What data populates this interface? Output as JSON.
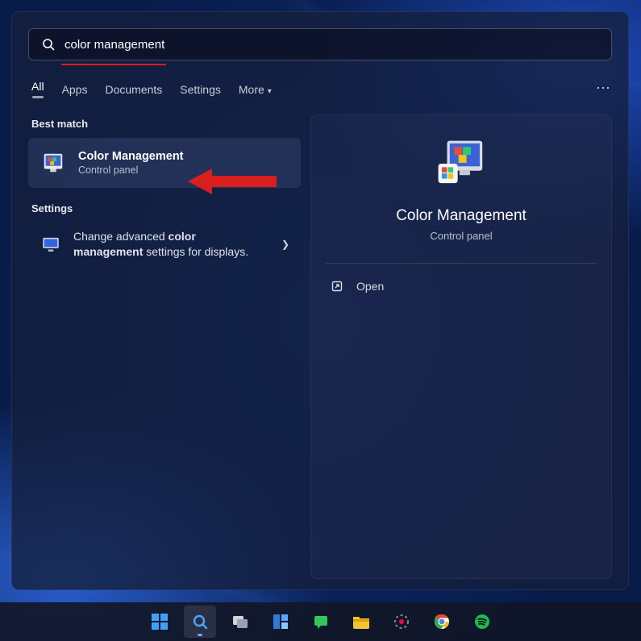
{
  "search": {
    "value": "color management"
  },
  "tabs": {
    "items": [
      "All",
      "Apps",
      "Documents",
      "Settings",
      "More"
    ],
    "active_index": 0
  },
  "left": {
    "best_match_label": "Best match",
    "result": {
      "title": "Color Management",
      "subtitle": "Control panel"
    },
    "settings_label": "Settings",
    "settings_item": {
      "prefix": "Change advanced ",
      "bold": "color management",
      "suffix": " settings for displays."
    }
  },
  "detail": {
    "title": "Color Management",
    "subtitle": "Control panel",
    "open_label": "Open"
  },
  "taskbar": {
    "items": [
      {
        "name": "start-button"
      },
      {
        "name": "search-button"
      },
      {
        "name": "task-view-button"
      },
      {
        "name": "widgets-button"
      },
      {
        "name": "chat-button"
      },
      {
        "name": "file-explorer-button"
      },
      {
        "name": "app-circle-button"
      },
      {
        "name": "chrome-button"
      },
      {
        "name": "spotify-button"
      }
    ]
  }
}
